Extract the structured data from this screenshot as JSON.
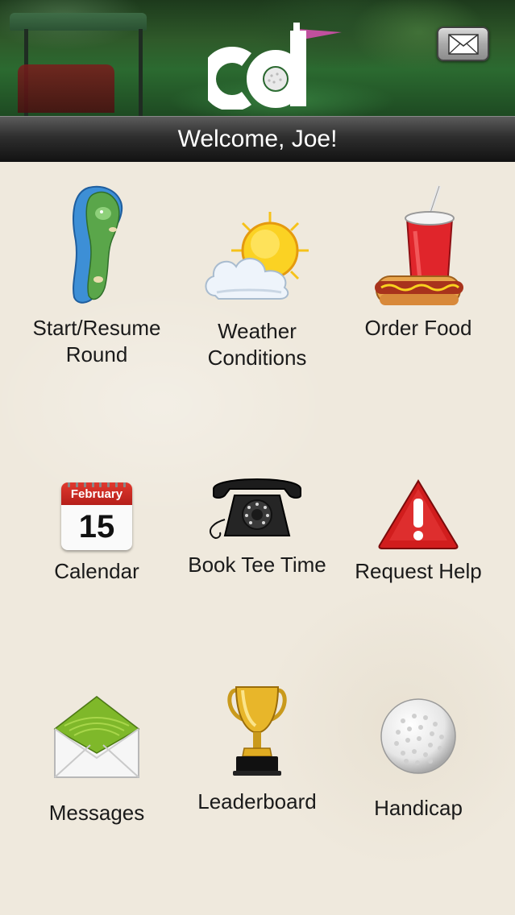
{
  "header": {
    "welcome_text": "Welcome, Joe!",
    "logo_text": "cd",
    "logo_flag_color": "#c0509e",
    "mail_icon": "envelope-icon"
  },
  "menu": [
    {
      "label_line1": "Start/Resume",
      "label_line2": "Round",
      "icon": "golf-course-icon"
    },
    {
      "label_line1": "Weather",
      "label_line2": "Conditions",
      "icon": "weather-icon"
    },
    {
      "label_line1": "Order Food",
      "label_line2": "",
      "icon": "food-icon"
    },
    {
      "label_line1": "Calendar",
      "label_line2": "",
      "icon": "calendar-icon",
      "month": "February",
      "day": "15"
    },
    {
      "label_line1": "Book Tee Time",
      "label_line2": "",
      "icon": "telephone-icon"
    },
    {
      "label_line1": "Request Help",
      "label_line2": "",
      "icon": "warning-icon"
    },
    {
      "label_line1": "Messages",
      "label_line2": "",
      "icon": "envelope-icon"
    },
    {
      "label_line1": "Leaderboard",
      "label_line2": "",
      "icon": "trophy-icon"
    },
    {
      "label_line1": "Handicap",
      "label_line2": "",
      "icon": "golf-ball-icon"
    }
  ]
}
